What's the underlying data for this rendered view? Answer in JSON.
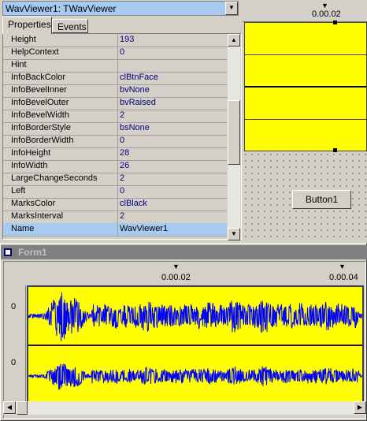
{
  "inspector": {
    "selected_object": "WavViewer1: TWavViewer",
    "tabs": [
      {
        "label": "Properties"
      },
      {
        "label": "Events"
      }
    ],
    "properties": [
      {
        "name": "Height",
        "value": "193"
      },
      {
        "name": "HelpContext",
        "value": "0"
      },
      {
        "name": "Hint",
        "value": ""
      },
      {
        "name": "InfoBackColor",
        "value": "clBtnFace"
      },
      {
        "name": "InfoBevelInner",
        "value": "bvNone"
      },
      {
        "name": "InfoBevelOuter",
        "value": "bvRaised"
      },
      {
        "name": "InfoBevelWidth",
        "value": "2"
      },
      {
        "name": "InfoBorderStyle",
        "value": "bsNone"
      },
      {
        "name": "InfoBorderWidth",
        "value": "0"
      },
      {
        "name": "InfoHeight",
        "value": "28"
      },
      {
        "name": "InfoWidth",
        "value": "26"
      },
      {
        "name": "LargeChangeSeconds",
        "value": "2"
      },
      {
        "name": "Left",
        "value": "0"
      },
      {
        "name": "MarksColor",
        "value": "clBlack"
      },
      {
        "name": "MarksInterval",
        "value": "2"
      },
      {
        "name": "Name",
        "value": "WavViewer1"
      }
    ]
  },
  "design": {
    "ruler_label": "0.00.02",
    "button_label": "Button1"
  },
  "form1": {
    "title": "Form1",
    "ruler": [
      {
        "label": "0.00.02"
      },
      {
        "label": "0.00.04"
      }
    ],
    "channels": [
      {
        "label": "0"
      },
      {
        "label": "0"
      }
    ]
  },
  "colors": {
    "wave_bg": "#ffff00",
    "wave": "#0000ff",
    "selection": "#a6caf0"
  }
}
